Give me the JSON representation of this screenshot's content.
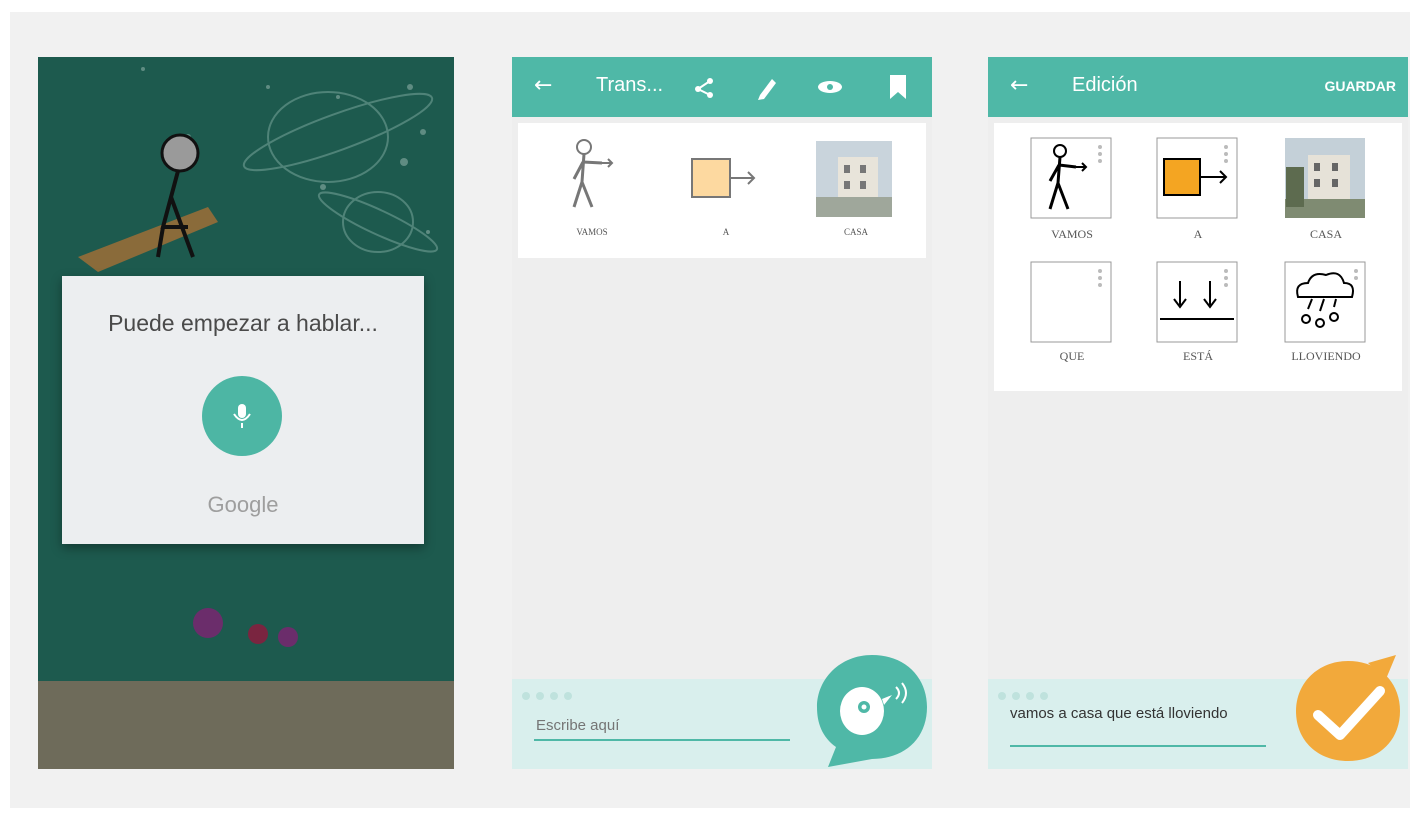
{
  "screen1": {
    "prompt": "Puede empezar a hablar...",
    "provider": "Google",
    "mic_icon": "microphone-icon"
  },
  "screen2": {
    "title": "Trans...",
    "toolbar_icons": [
      "back-arrow-icon",
      "share-icon",
      "pencil-icon",
      "eye-icon",
      "bookmark-icon"
    ],
    "pictograms": [
      {
        "label": "VAMOS",
        "icon": "walking-person-icon"
      },
      {
        "label": "A",
        "icon": "arrow-to-box-icon"
      },
      {
        "label": "CASA",
        "icon": "house-photo"
      }
    ],
    "input_placeholder": "Escribe aquí",
    "fab_icon": "bird-speaking-icon"
  },
  "screen3": {
    "title": "Edición",
    "save_label": "GUARDAR",
    "pictograms": [
      {
        "label": "VAMOS",
        "icon": "walking-person-icon"
      },
      {
        "label": "A",
        "icon": "arrow-to-box-icon"
      },
      {
        "label": "CASA",
        "icon": "house-photo"
      },
      {
        "label": "QUE",
        "icon": "blank-icon"
      },
      {
        "label": "ESTÁ",
        "icon": "down-arrows-icon"
      },
      {
        "label": "LLOVIENDO",
        "icon": "rain-cloud-icon"
      }
    ],
    "input_text": "vamos a casa que está lloviendo",
    "fab_icon": "checkmark-icon"
  },
  "colors": {
    "teal": "#4fb8a7",
    "dark_green": "#1d5a4e",
    "orange": "#f2a93b",
    "light_teal": "#d9efed"
  }
}
